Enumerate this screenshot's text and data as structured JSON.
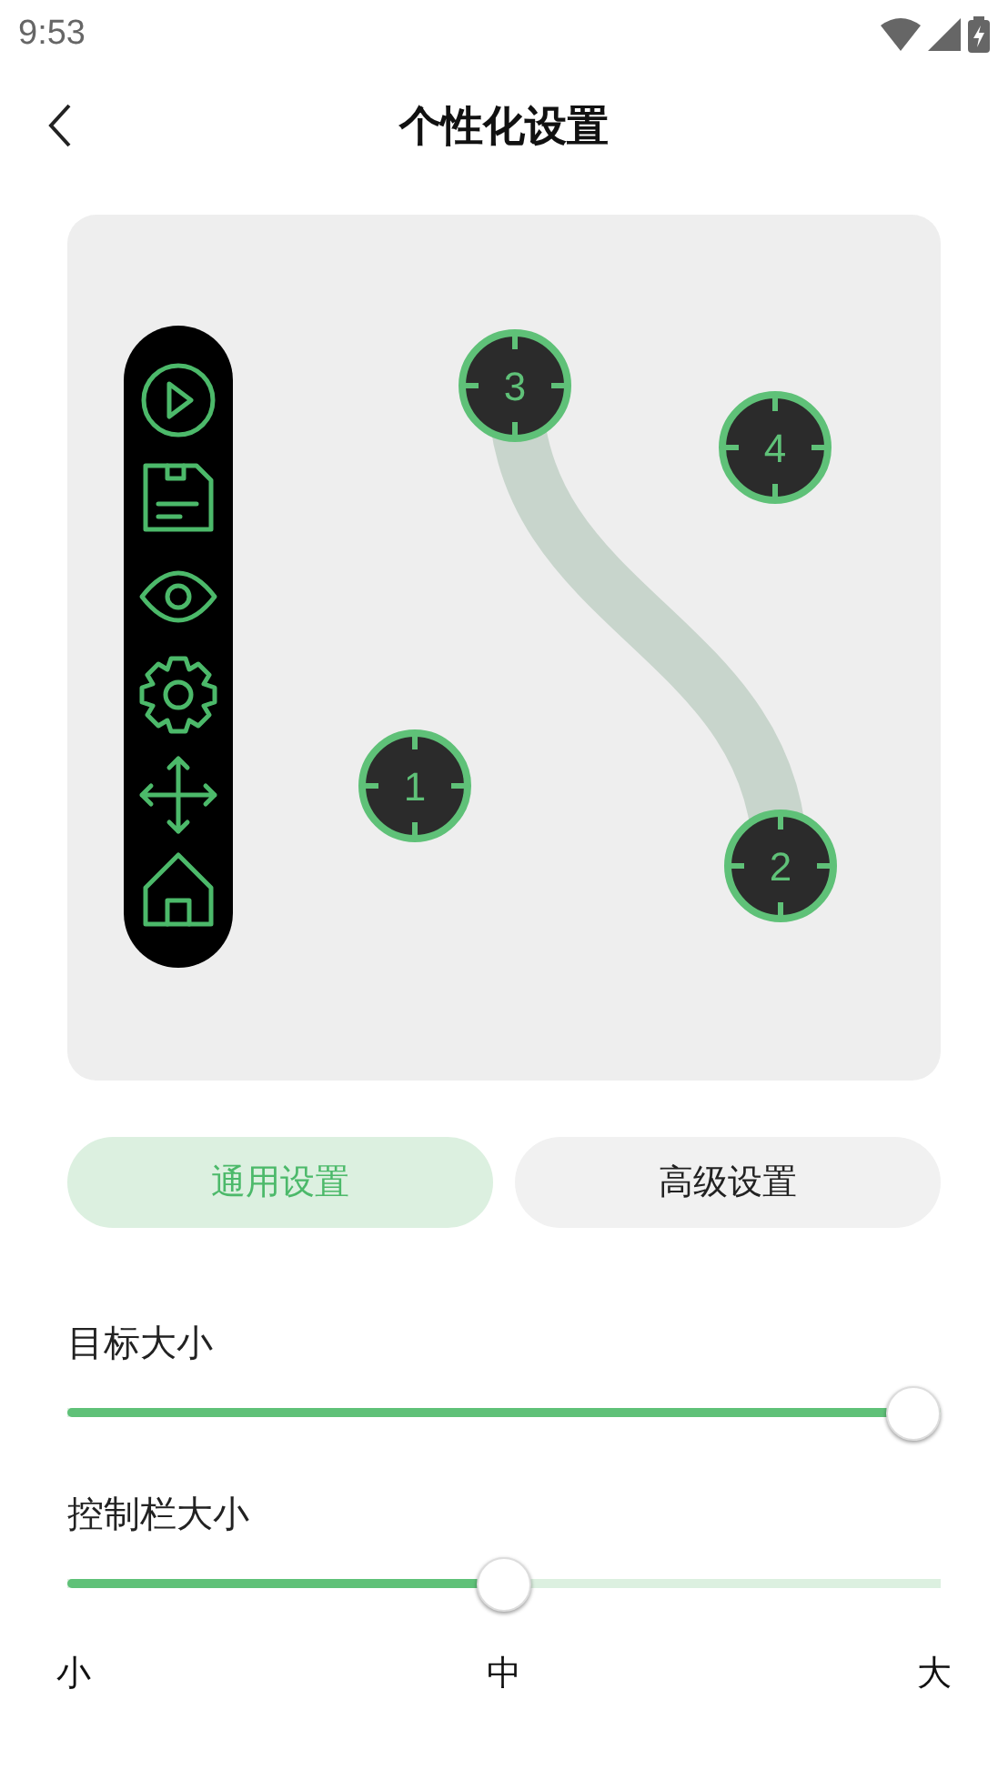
{
  "status_bar": {
    "time": "9:53"
  },
  "header": {
    "title": "个性化设置"
  },
  "preview": {
    "targets": [
      {
        "label": "3"
      },
      {
        "label": "4"
      },
      {
        "label": "1"
      },
      {
        "label": "2"
      }
    ]
  },
  "tabs": [
    {
      "label": "通用设置",
      "selected": true
    },
    {
      "label": "高级设置",
      "selected": false
    }
  ],
  "sliders": [
    {
      "label": "目标大小",
      "level": 1.0
    },
    {
      "label": "控制栏大小",
      "level": 0.5,
      "scale_labels": [
        "小",
        "中",
        "大"
      ]
    }
  ]
}
